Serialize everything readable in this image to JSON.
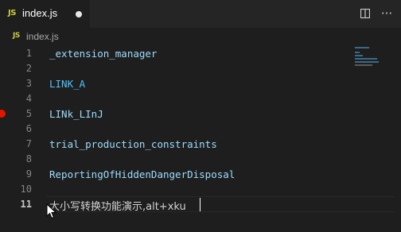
{
  "tab": {
    "icon_text": "JS",
    "filename": "index.js"
  },
  "breadcrumb": {
    "icon_text": "JS",
    "filename": "index.js"
  },
  "actions": {
    "more_label": "···"
  },
  "colors": {
    "editor_bg": "#1e1e1e",
    "tab_bar_bg": "#252526",
    "variable": "#9cdcfe",
    "constant": "#4fc1ff",
    "plain_text": "#d4d4d4",
    "line_number": "#858585",
    "breakpoint": "#e51400",
    "js_icon": "#cbcb41"
  },
  "lines": [
    {
      "num": "1",
      "text": "_extension_manager",
      "kind": "var"
    },
    {
      "num": "2",
      "text": "",
      "kind": "var"
    },
    {
      "num": "3",
      "text": "LINK_A",
      "kind": "const"
    },
    {
      "num": "4",
      "text": "",
      "kind": "var"
    },
    {
      "num": "5",
      "text": "LINk_LInJ",
      "kind": "var",
      "breakpoint": true
    },
    {
      "num": "6",
      "text": "",
      "kind": "var"
    },
    {
      "num": "7",
      "text": "trial_production_constraints",
      "kind": "var"
    },
    {
      "num": "8",
      "text": "",
      "kind": "var"
    },
    {
      "num": "9",
      "text": "ReportingOfHiddenDangerDisposal",
      "kind": "var"
    },
    {
      "num": "10",
      "text": "",
      "kind": "var"
    },
    {
      "num": "11",
      "text": "大小写转换功能演示,alt+xku",
      "kind": "plain",
      "active": true
    }
  ]
}
